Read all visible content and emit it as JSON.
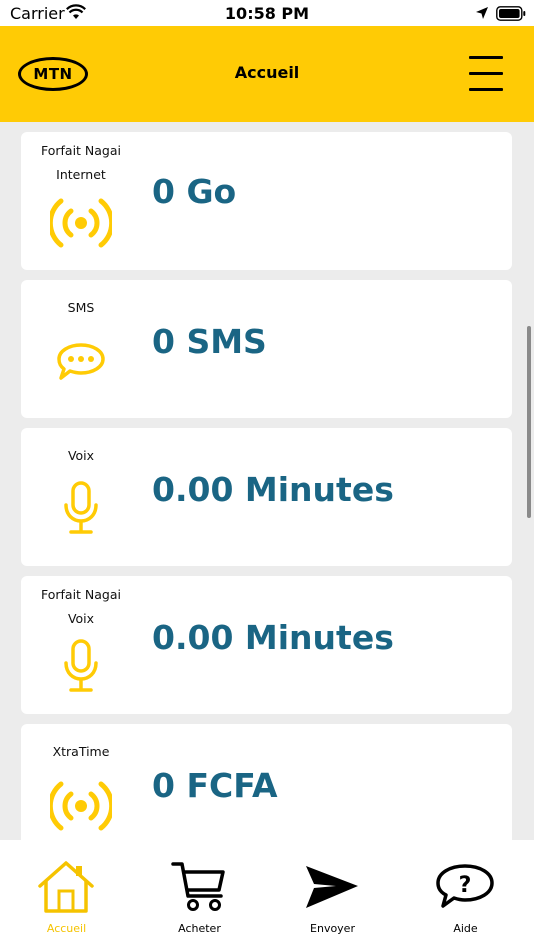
{
  "status_bar": {
    "carrier": "Carrier",
    "time": "10:58 PM"
  },
  "header": {
    "logo_text": "MTN",
    "title": "Accueil",
    "brand_color": "#ffcb05"
  },
  "cards": [
    {
      "label_top": "Forfait Nagai",
      "label": "Internet",
      "value": "0 Go",
      "icon": "broadcast-icon"
    },
    {
      "label_top": "",
      "label": "SMS",
      "value": "0 SMS",
      "icon": "chat-bubble-icon"
    },
    {
      "label_top": "",
      "label": "Voix",
      "value": "0.00 Minutes",
      "icon": "microphone-icon"
    },
    {
      "label_top": "Forfait Nagai",
      "label": "Voix",
      "value": "0.00 Minutes",
      "icon": "microphone-icon"
    },
    {
      "label_top": "",
      "label": "XtraTime",
      "value": "0 FCFA",
      "icon": "broadcast-icon"
    }
  ],
  "value_color": "#1a6584",
  "icon_color": "#ffcb05",
  "tabs": [
    {
      "label": "Accueil",
      "icon": "home-icon",
      "active": true
    },
    {
      "label": "Acheter",
      "icon": "cart-icon",
      "active": false
    },
    {
      "label": "Envoyer",
      "icon": "send-icon",
      "active": false
    },
    {
      "label": "Aide",
      "icon": "help-bubble-icon",
      "active": false
    }
  ]
}
